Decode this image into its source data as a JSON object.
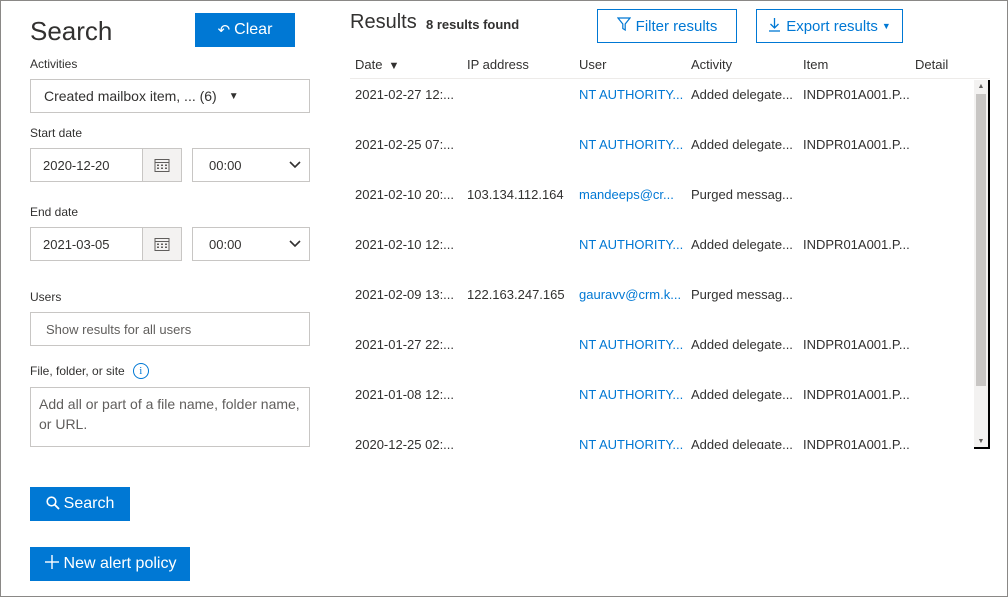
{
  "search_panel": {
    "title": "Search",
    "clear_label": "Clear",
    "activities_label": "Activities",
    "activities_value": "Created mailbox item, ... (6)",
    "start_date_label": "Start date",
    "start_date_value": "2020-12-20",
    "start_time_value": "00:00",
    "end_date_label": "End date",
    "end_date_value": "2021-03-05",
    "end_time_value": "00:00",
    "users_label": "Users",
    "users_placeholder": "Show results for all users",
    "file_label": "File, folder, or site",
    "file_placeholder": "Add all or part of a file name, folder name, or URL.",
    "search_button": "Search",
    "new_alert_button": "New alert policy"
  },
  "results": {
    "title": "Results",
    "count_text": "8 results found",
    "filter_button": "Filter results",
    "export_button": "Export results",
    "columns": [
      "Date",
      "IP address",
      "User",
      "Activity",
      "Item",
      "Detail"
    ],
    "rows": [
      {
        "date": "2021-02-27 12:...",
        "ip": "",
        "user": "NT AUTHORITY...",
        "activity": "Added delegate...",
        "item": "INDPR01A001.P...",
        "detail": ""
      },
      {
        "date": "2021-02-25 07:...",
        "ip": "",
        "user": "NT AUTHORITY...",
        "activity": "Added delegate...",
        "item": "INDPR01A001.P...",
        "detail": ""
      },
      {
        "date": "2021-02-10 20:...",
        "ip": "103.134.112.164",
        "user": "mandeeps@cr...",
        "activity": "Purged messag...",
        "item": "",
        "detail": ""
      },
      {
        "date": "2021-02-10 12:...",
        "ip": "",
        "user": "NT AUTHORITY...",
        "activity": "Added delegate...",
        "item": "INDPR01A001.P...",
        "detail": ""
      },
      {
        "date": "2021-02-09 13:...",
        "ip": "122.163.247.165",
        "user": "gauravv@crm.k...",
        "activity": "Purged messag...",
        "item": "",
        "detail": ""
      },
      {
        "date": "2021-01-27 22:...",
        "ip": "",
        "user": "NT AUTHORITY...",
        "activity": "Added delegate...",
        "item": "INDPR01A001.P...",
        "detail": ""
      },
      {
        "date": "2021-01-08 12:...",
        "ip": "",
        "user": "NT AUTHORITY...",
        "activity": "Added delegate...",
        "item": "INDPR01A001.P...",
        "detail": ""
      },
      {
        "date": "2020-12-25 02:...",
        "ip": "",
        "user": "NT AUTHORITY...",
        "activity": "Added delegate...",
        "item": "INDPR01A001.P...",
        "detail": ""
      }
    ]
  },
  "icons": {
    "clear": "undo-icon",
    "calendar": "calendar-icon",
    "info": "info-icon",
    "search": "search-icon",
    "add": "plus-icon",
    "filter": "filter-icon",
    "export": "download-icon",
    "sort": "sort-descending-icon"
  },
  "colors": {
    "accent": "#0078d4",
    "text": "#323130",
    "border": "#c8c6c4"
  }
}
